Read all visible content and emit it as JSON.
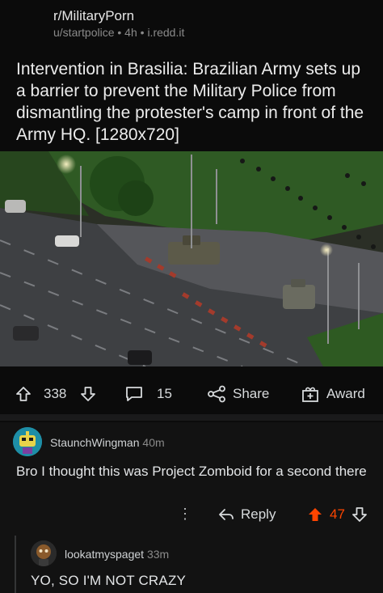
{
  "post": {
    "subreddit": "r/MilitaryPorn",
    "user": "u/startpolice",
    "age": "4h",
    "domain": "i.redd.it",
    "title": "Intervention in Brasilia: Brazilian Army sets up a barrier to prevent the Military Police from dismantling the protester's camp in front of the Army HQ. [1280x720]",
    "upvotes": "338",
    "comments": "15",
    "share_label": "Share",
    "award_label": "Award"
  },
  "comments": [
    {
      "author": "StaunchWingman",
      "age": "40m",
      "body": "Bro I thought this was Project Zomboid for a second there",
      "reply_label": "Reply",
      "score": "47",
      "more_icon": "more-vertical-icon"
    },
    {
      "author": "lookatmyspaget",
      "age": "33m",
      "body": "YO, SO I'M NOT CRAZY"
    }
  ],
  "colors": {
    "background": "#0b0b0b",
    "comment_bg": "#121212",
    "upvote_accent": "#ff4500",
    "muted_text": "#8a8a8a"
  }
}
